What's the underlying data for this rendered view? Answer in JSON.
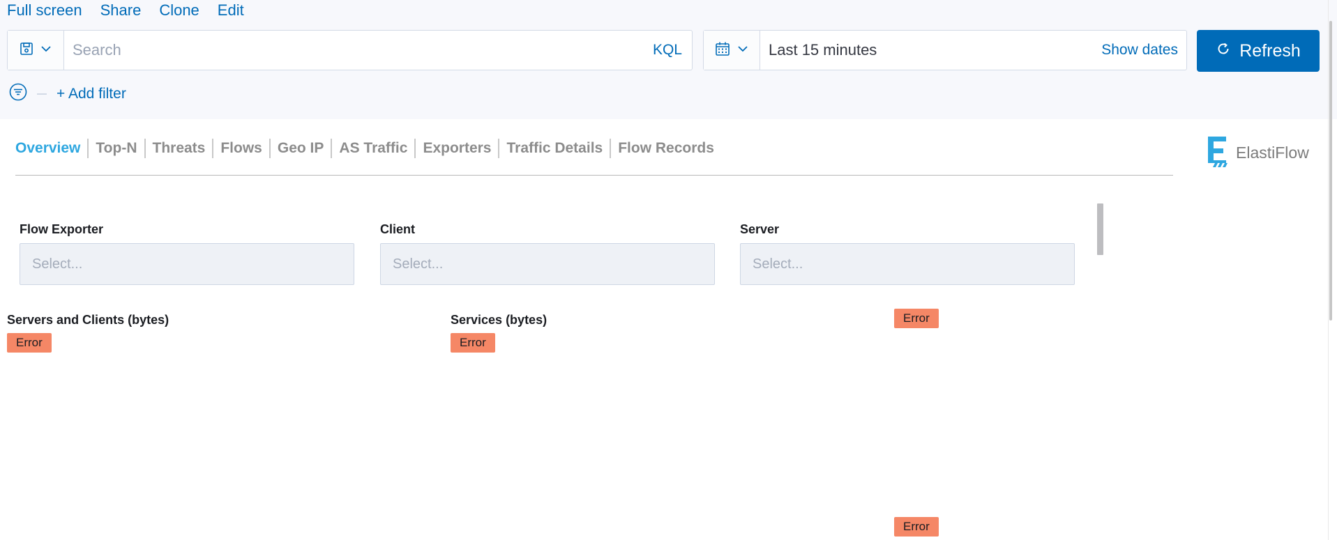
{
  "top_links": [
    "Full screen",
    "Share",
    "Clone",
    "Edit"
  ],
  "query": {
    "placeholder": "Search",
    "language": "KQL"
  },
  "date": {
    "range": "Last 15 minutes",
    "show_dates": "Show dates"
  },
  "refresh_label": "Refresh",
  "filter": {
    "add_label": "+ Add filter"
  },
  "tabs": [
    "Overview",
    "Top-N",
    "Threats",
    "Flows",
    "Geo IP",
    "AS Traffic",
    "Exporters",
    "Traffic Details",
    "Flow Records"
  ],
  "active_tab": "Overview",
  "logo_text": "ElastiFlow",
  "controls": [
    {
      "label": "Flow Exporter",
      "placeholder": "Select..."
    },
    {
      "label": "Client",
      "placeholder": "Select..."
    },
    {
      "label": "Server",
      "placeholder": "Select..."
    }
  ],
  "panels": [
    {
      "title": "Servers and Clients (bytes)",
      "status": "Error"
    },
    {
      "title": "Services (bytes)",
      "status": "Error"
    },
    {
      "title": "",
      "status": "Error"
    },
    {
      "title": "",
      "status": "Error"
    }
  ],
  "colors": {
    "accent": "#006bb8",
    "active_tab": "#2ea7e0",
    "error": "#f58766",
    "logo": "#2ea7e0"
  },
  "icons": [
    "save-icon",
    "chevron-down-icon",
    "calendar-icon",
    "refresh-icon",
    "filter-icon",
    "elastiflow-logo-icon"
  ]
}
